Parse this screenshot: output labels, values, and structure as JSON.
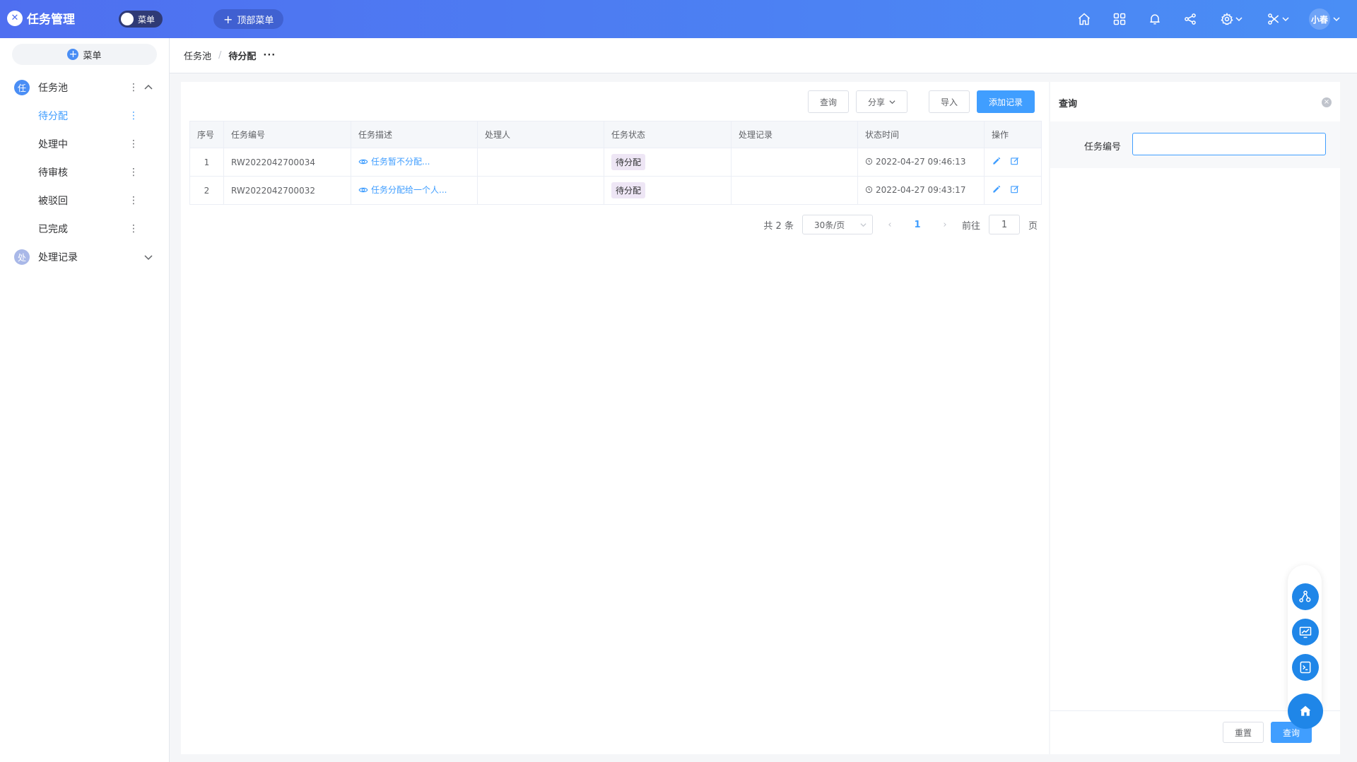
{
  "app": {
    "title": "任务管理",
    "toggle_label": "菜单",
    "top_menu_label": "顶部菜单",
    "user": "小春"
  },
  "sidebar": {
    "menu_button": "菜单",
    "groups": [
      {
        "badge": "任",
        "label": "任务池",
        "color": "#4a8ef5"
      },
      {
        "badge": "处",
        "label": "处理记录",
        "color": "#a9b8e8"
      }
    ],
    "items": [
      {
        "label": "待分配",
        "active": true
      },
      {
        "label": "处理中"
      },
      {
        "label": "待审核"
      },
      {
        "label": "被驳回"
      },
      {
        "label": "已完成"
      }
    ]
  },
  "breadcrumb": {
    "root": "任务池",
    "sep": "/",
    "current": "待分配",
    "more": "···"
  },
  "toolbar": {
    "query": "查询",
    "share": "分享",
    "import": "导入",
    "add": "添加记录"
  },
  "table": {
    "columns": [
      "序号",
      "任务编号",
      "任务描述",
      "处理人",
      "任务状态",
      "处理记录",
      "状态时间",
      "操作"
    ],
    "rows": [
      {
        "index": "1",
        "code": "RW2022042700034",
        "desc": "任务暂不分配...",
        "handler": "",
        "status": "待分配",
        "record": "",
        "time": "2022-04-27 09:46:13"
      },
      {
        "index": "2",
        "code": "RW2022042700032",
        "desc": "任务分配给一个人...",
        "handler": "",
        "status": "待分配",
        "record": "",
        "time": "2022-04-27 09:43:17"
      }
    ]
  },
  "pager": {
    "total": "共 2 条",
    "size": "30条/页",
    "page": "1",
    "goto": "前往",
    "goto_value": "1",
    "unit": "页"
  },
  "query_panel": {
    "title": "查询",
    "field_label": "任务编号",
    "field_value": "",
    "reset": "重置",
    "submit": "查询"
  },
  "colors": {
    "primary": "#409eff",
    "topbar_start": "#4f6ff0",
    "topbar_end": "#4a8ef5",
    "tag_bg": "#eee6f5"
  }
}
